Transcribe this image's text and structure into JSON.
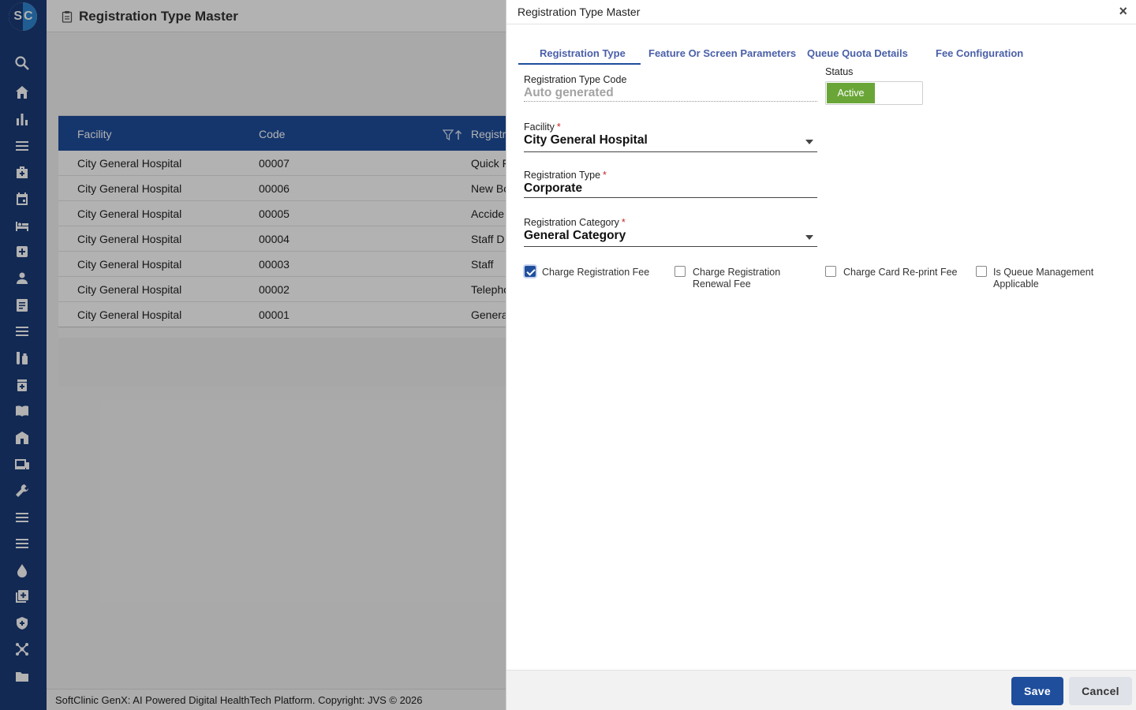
{
  "app": {
    "logo_left": "S",
    "logo_right": "C",
    "page_title": "Registration Type Master",
    "copyright": "SoftClinic GenX: AI Powered Digital HealthTech Platform. Copyright: JVS © 2026"
  },
  "sidebar": {
    "icons": [
      "search-icon",
      "home-icon",
      "bar-chart-icon",
      "menu-icon",
      "medical-bag-icon",
      "calendar-icon",
      "bed-icon",
      "hospital-plus-icon",
      "person-icon",
      "document-icon",
      "list-icon",
      "lab-icon",
      "pharmacy-icon",
      "book-icon",
      "building-icon",
      "devices-icon",
      "wrench-icon",
      "menu-icon",
      "menu-icon",
      "drop-icon",
      "add-box-icon",
      "shield-icon",
      "network-icon",
      "folder-icon"
    ]
  },
  "grid": {
    "columns": [
      "Facility",
      "Code",
      "Registra"
    ],
    "rows": [
      {
        "facility": "City General Hospital",
        "code": "00007",
        "type": "Quick F"
      },
      {
        "facility": "City General Hospital",
        "code": "00006",
        "type": "New Bo"
      },
      {
        "facility": "City General Hospital",
        "code": "00005",
        "type": "Accide"
      },
      {
        "facility": "City General Hospital",
        "code": "00004",
        "type": "Staff D"
      },
      {
        "facility": "City General Hospital",
        "code": "00003",
        "type": "Staff"
      },
      {
        "facility": "City General Hospital",
        "code": "00002",
        "type": "Telepho"
      },
      {
        "facility": "City General Hospital",
        "code": "00001",
        "type": "Genera"
      }
    ]
  },
  "dialog": {
    "title": "Registration Type Master",
    "close_label": "×",
    "tabs": [
      {
        "label": "Registration Type",
        "active": true
      },
      {
        "label": "Feature Or Screen Parameters",
        "active": false
      },
      {
        "label": "Queue Quota Details",
        "active": false
      },
      {
        "label": "Fee Configuration",
        "active": false
      }
    ],
    "fields": {
      "code_label": "Registration Type Code",
      "code_placeholder": "Auto generated",
      "status_label": "Status",
      "status_value": "Active",
      "facility_label": "Facility",
      "facility_value": "City General Hospital",
      "type_label": "Registration Type",
      "type_value": "Corporate",
      "category_label": "Registration Category",
      "category_value": "General Category",
      "required_mark": "*"
    },
    "checkboxes": [
      {
        "label_line1": "Charge Registration Fee",
        "label_line2": "",
        "checked": true
      },
      {
        "label_line1": "Charge Registration",
        "label_line2": "Renewal Fee",
        "checked": false
      },
      {
        "label_line1": "Charge Card Re-print Fee",
        "label_line2": "",
        "checked": false
      },
      {
        "label_line1": "Is Queue Management",
        "label_line2": "Applicable",
        "checked": false
      }
    ],
    "buttons": {
      "save": "Save",
      "cancel": "Cancel"
    }
  }
}
